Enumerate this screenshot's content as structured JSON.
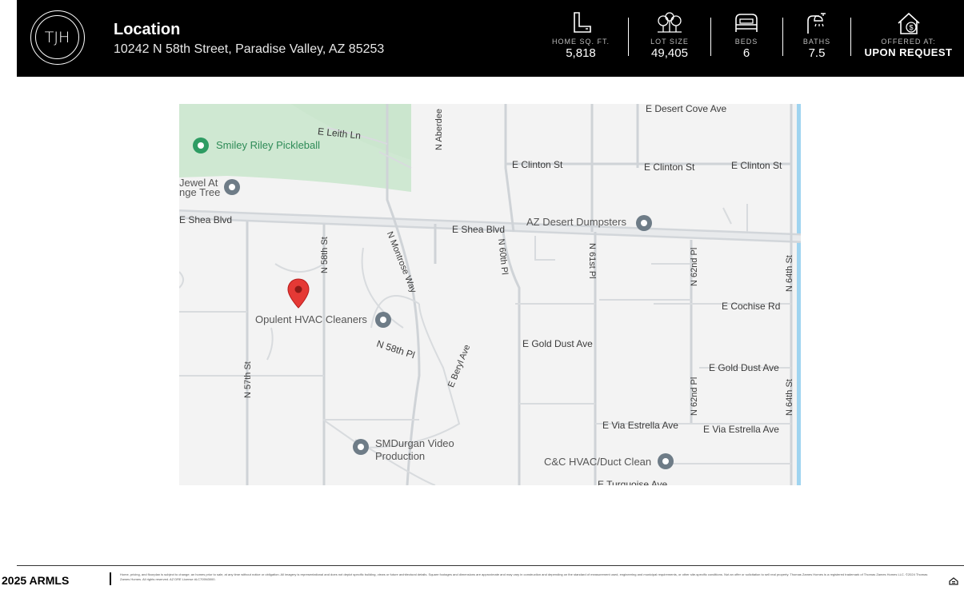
{
  "header": {
    "logo_text": "TJH",
    "title": "Location",
    "address": "10242 N 58th Street, Paradise Valley, AZ 85253",
    "stats": [
      {
        "icon": "floorplan-icon",
        "label": "HOME SQ. FT.",
        "value": "5,818"
      },
      {
        "icon": "trees-icon",
        "label": "LOT SIZE",
        "value": "49,405"
      },
      {
        "icon": "bed-icon",
        "label": "BEDS",
        "value": "6"
      },
      {
        "icon": "shower-icon",
        "label": "BATHS",
        "value": "7.5"
      },
      {
        "icon": "house-dollar-icon",
        "label": "OFFERED AT:",
        "value": "UPON REQUEST"
      }
    ]
  },
  "map": {
    "streets": {
      "e_leith_ln": "E Leith Ln",
      "n_aberdeen": "N Aberdee",
      "e_desert_cove_ave": "E Desert Cove Ave",
      "e_clinton_st_1": "E Clinton St",
      "e_clinton_st_2": "E Clinton St",
      "e_clinton_st_3": "E Clinton St",
      "e_shea_blvd_1": "E Shea Blvd",
      "e_shea_blvd_2": "E Shea Blvd",
      "n_58th_st": "N 58th St",
      "n_montrose_way": "N Montrose Way",
      "n_60th_pl": "N 60th Pl",
      "n_61st_pl": "N 61st Pl",
      "n_62nd_pl_1": "N 62nd Pl",
      "n_62nd_pl_2": "N 62nd Pl",
      "n_64th_st_1": "N 64th St",
      "n_64th_st_2": "N 64th St",
      "e_cochise_rd": "E Cochise Rd",
      "e_gold_dust_ave_1": "E Gold Dust Ave",
      "e_gold_dust_ave_2": "E Gold Dust Ave",
      "n_58th_pl": "N 58th Pl",
      "e_beryl_ave": "E Beryl Ave",
      "n_57th_st": "N 57th St",
      "e_via_estrella_ave_1": "E Via Estrella Ave",
      "e_via_estrella_ave_2": "E Via Estrella Ave",
      "e_turquoise_ave": "E Turquoise Ave"
    },
    "pois": {
      "smiley_riley": "Smiley Riley Pickleball",
      "jewel_line1": "Jewel At",
      "jewel_line2": "nge Tree",
      "az_desert_dumpsters": "AZ Desert Dumpsters",
      "opulent_hvac": "Opulent HVAC Cleaners",
      "smdurgan_line1": "SMDurgan Video",
      "smdurgan_line2": "Production",
      "cc_hvac": "C&C HVAC/Duct Clean"
    }
  },
  "footer": {
    "left_text": "2025 ARMLS",
    "fine_print": "Home, pricing, and floorplan is subject to change; an homes prior to sale, at any time without notice or obligation. All imagery is representational and does not depict specific building, views or future architectural details. Square footages and dimensions are approximate and may vary in construction and depending on the standard of measurement used, engineering and municipal requirements, or other site-specific conditions. Not an offer or solicitation to sell real property. Thomas Zames Homes is a registered trademark of Thomas Zames Homes LLC. ©2024 Thomas Zames Homes. All rights reserved. AZ DRE License #LC705N3000.",
    "icon": "equal-housing-icon"
  }
}
